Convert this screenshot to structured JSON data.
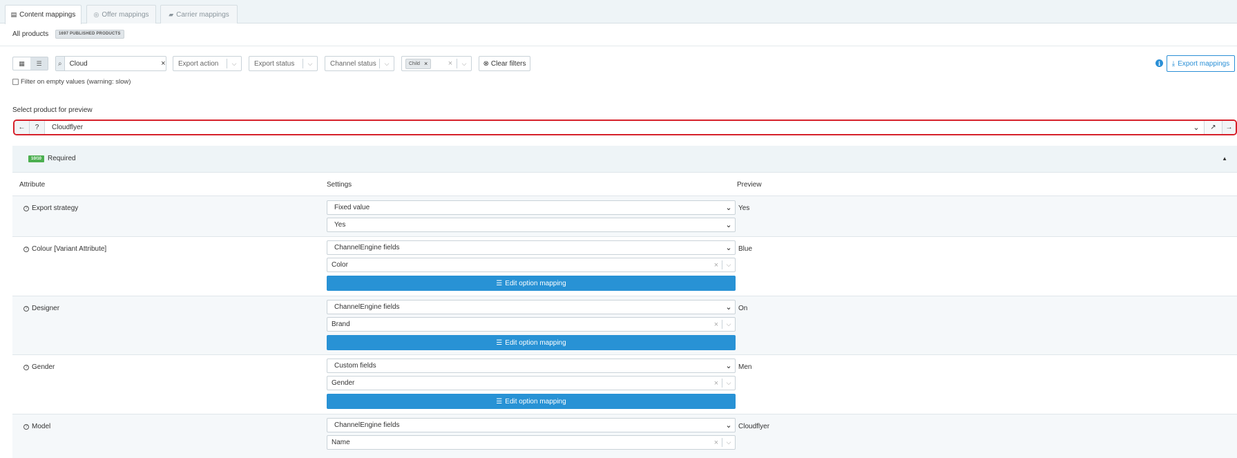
{
  "tabs": [
    {
      "label": "Content mappings",
      "icon": "id-card-icon"
    },
    {
      "label": "Offer mappings",
      "icon": "coins-icon"
    },
    {
      "label": "Carrier mappings",
      "icon": "truck-icon"
    }
  ],
  "subheader": {
    "title": "All products",
    "badge": "1697 PUBLISHED PRODUCTS"
  },
  "filters": {
    "search_value": "Cloud",
    "export_action": "Export action",
    "export_status": "Export status",
    "channel_status": "Channel status",
    "chip": "Child",
    "clear_filters": "Clear filters",
    "export_mappings": "Export mappings",
    "empty_values_label": "Filter on empty values (warning: slow)"
  },
  "preview_select": {
    "title": "Select product for preview",
    "value": "Cloudflyer"
  },
  "section": {
    "badge": "10/10",
    "title": "Required"
  },
  "table": {
    "headers": {
      "attribute": "Attribute",
      "settings": "Settings",
      "preview": "Preview"
    },
    "edit_label": "Edit option mapping",
    "rows": [
      {
        "attribute": "Export strategy",
        "source": "Fixed value",
        "field": "Yes",
        "preview": "Yes"
      },
      {
        "attribute": "Colour [Variant Attribute]",
        "source": "ChannelEngine fields",
        "field": "Color",
        "preview": "Blue"
      },
      {
        "attribute": "Designer",
        "source": "ChannelEngine fields",
        "field": "Brand",
        "preview": "On"
      },
      {
        "attribute": "Gender",
        "source": "Custom fields",
        "field": "Gender",
        "preview": "Men"
      },
      {
        "attribute": "Model",
        "source": "ChannelEngine fields",
        "field": "Name",
        "preview": "Cloudflyer"
      }
    ]
  },
  "colors": {
    "accent": "#2892d5",
    "highlight": "#d6202a",
    "success": "#4caf50"
  }
}
